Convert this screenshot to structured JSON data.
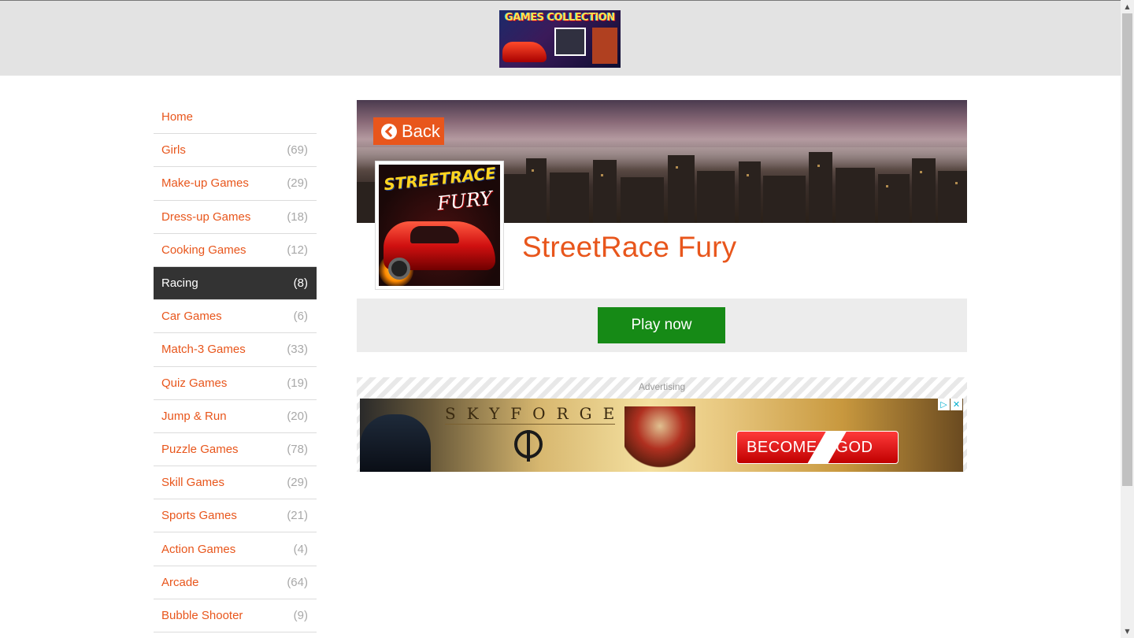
{
  "header": {
    "logo_text": "GAMES COLLECTION"
  },
  "sidebar": {
    "items": [
      {
        "label": "Home",
        "count": ""
      },
      {
        "label": "Girls",
        "count": "(69)"
      },
      {
        "label": "Make-up Games",
        "count": "(29)"
      },
      {
        "label": "Dress-up Games",
        "count": "(18)"
      },
      {
        "label": "Cooking Games",
        "count": "(12)"
      },
      {
        "label": "Racing",
        "count": "(8)",
        "active": true
      },
      {
        "label": "Car Games",
        "count": "(6)"
      },
      {
        "label": "Match-3 Games",
        "count": "(33)"
      },
      {
        "label": "Quiz Games",
        "count": "(19)"
      },
      {
        "label": "Jump & Run",
        "count": "(20)"
      },
      {
        "label": "Puzzle Games",
        "count": "(78)"
      },
      {
        "label": "Skill Games",
        "count": "(29)"
      },
      {
        "label": "Sports Games",
        "count": "(21)"
      },
      {
        "label": "Action Games",
        "count": "(4)"
      },
      {
        "label": "Arcade",
        "count": "(64)"
      },
      {
        "label": "Bubble Shooter",
        "count": "(9)"
      }
    ]
  },
  "game": {
    "back_label": "Back",
    "title": "StreetRace Fury",
    "thumb_line1": "STREETRACE",
    "thumb_line2": "FURY",
    "play_label": "Play now"
  },
  "ad": {
    "label": "Advertising",
    "brand": "SKYFORGE",
    "cta": "BECOME A GOD",
    "choice_icon": "ad-choices-icon",
    "close_icon": "close-icon"
  },
  "colors": {
    "accent": "#e8561c",
    "active_bg": "#333333",
    "play_green": "#168a16",
    "header_bg": "#e3e3e3"
  }
}
